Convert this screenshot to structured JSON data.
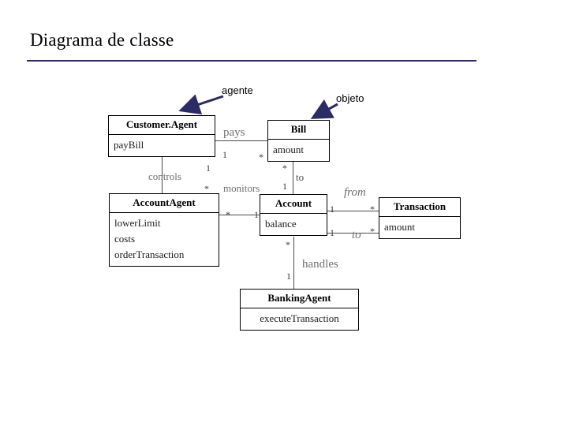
{
  "slide": {
    "title": "Diagrama de classe",
    "annotations": [
      {
        "name": "agente",
        "label": "agente"
      },
      {
        "name": "objeto",
        "label": "objeto"
      }
    ],
    "accent_color": "#2b2b66"
  },
  "diagram": {
    "type": "uml-class-diagram",
    "classes": [
      {
        "id": "customer-agent",
        "name": "Customer.Agent",
        "members": [
          "payBill"
        ]
      },
      {
        "id": "bill",
        "name": "Bill",
        "members": [
          "amount"
        ]
      },
      {
        "id": "account-agent",
        "name": "AccountAgent",
        "members": [
          "lowerLimit",
          "costs",
          "orderTransaction"
        ]
      },
      {
        "id": "account",
        "name": "Account",
        "members": [
          "balance"
        ]
      },
      {
        "id": "transaction",
        "name": "Transaction",
        "members": [
          "amount"
        ]
      },
      {
        "id": "banking-agent",
        "name": "BankingAgent",
        "members": [
          "executeTransaction"
        ]
      }
    ],
    "associations": [
      {
        "id": "pays",
        "label": "pays",
        "from": "customer-agent",
        "to": "bill",
        "from_mult": "1",
        "to_mult": "*"
      },
      {
        "id": "controls",
        "label": "controls",
        "from": "customer-agent",
        "to": "account-agent",
        "from_mult": "1",
        "to_mult": "*"
      },
      {
        "id": "monitors",
        "label": "monitors",
        "from": "account-agent",
        "to": "account",
        "from_mult": "*",
        "to_mult": "1"
      },
      {
        "id": "to-bill",
        "label": "to",
        "from": "bill",
        "to": "account",
        "from_mult": "*",
        "to_mult": "1"
      },
      {
        "id": "from",
        "label": "from",
        "from": "account",
        "to": "transaction",
        "from_mult": "1",
        "to_mult": "*"
      },
      {
        "id": "to-tx",
        "label": "to",
        "from": "account",
        "to": "transaction",
        "from_mult": "1",
        "to_mult": "*"
      },
      {
        "id": "handles",
        "label": "handles",
        "from": "account",
        "to": "banking-agent",
        "from_mult": "*",
        "to_mult": "1"
      }
    ],
    "multiplicity_labels": {
      "pays_left": "1",
      "pays_right": "*",
      "controls_top": "1",
      "controls_bottom": "*",
      "monitors_left": "*",
      "monitors_right": "1",
      "to_bill_top": "*",
      "to_bill_bottom": "1",
      "from_left": "1",
      "from_right": "*",
      "to_tx_left": "1",
      "to_tx_right": "*",
      "handles_top": "*",
      "handles_bottom": "1"
    }
  }
}
